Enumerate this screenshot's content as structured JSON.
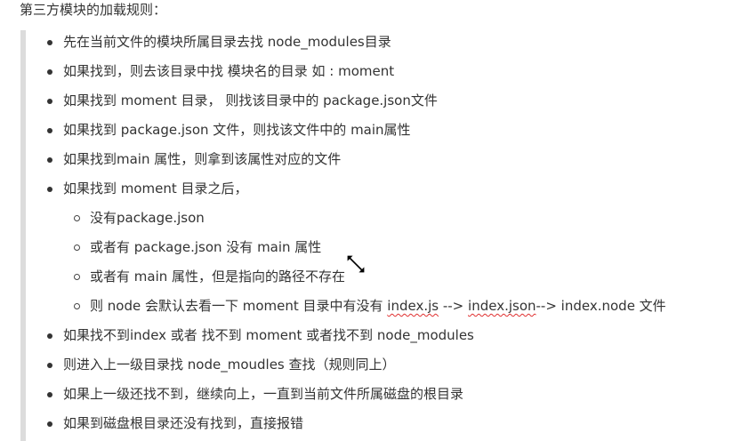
{
  "heading": "第三方模块的加载规则：",
  "items": [
    {
      "text": "先在当前文件的模块所属目录去找 node_modules目录"
    },
    {
      "text": "如果找到，则去该目录中找 模块名的目录  如 : moment"
    },
    {
      "text": "如果找到 moment 目录， 则找该目录中的 package.json文件"
    },
    {
      "text": "如果找到 package.json 文件，则找该文件中的 main属性"
    },
    {
      "text": "如果找到main 属性，则拿到该属性对应的文件"
    },
    {
      "text": "如果找到 moment 目录之后，",
      "sub": [
        {
          "text": "没有package.json"
        },
        {
          "text": "或者有 package.json 没有 main 属性"
        },
        {
          "text": "或者有 main 属性，但是指向的路径不存在"
        },
        {
          "pre": "则 node 会默认去看一下 moment 目录中有没有 ",
          "link1": "index.js",
          "mid": " --> ",
          "link2": "index.json",
          "post": "--> index.node 文件"
        }
      ]
    },
    {
      "text": "如果找不到index 或者 找不到 moment 或者找不到 node_modules"
    },
    {
      "text": "则进入上一级目录找 node_moudles 查找（规则同上）"
    },
    {
      "text": "如果上一级还找不到，继续向上，一直到当前文件所属磁盘的根目录"
    },
    {
      "text": "如果到磁盘根目录还没有找到，直接报错"
    }
  ],
  "cursor": {
    "icon": "resize-diagonal-cursor-icon"
  }
}
